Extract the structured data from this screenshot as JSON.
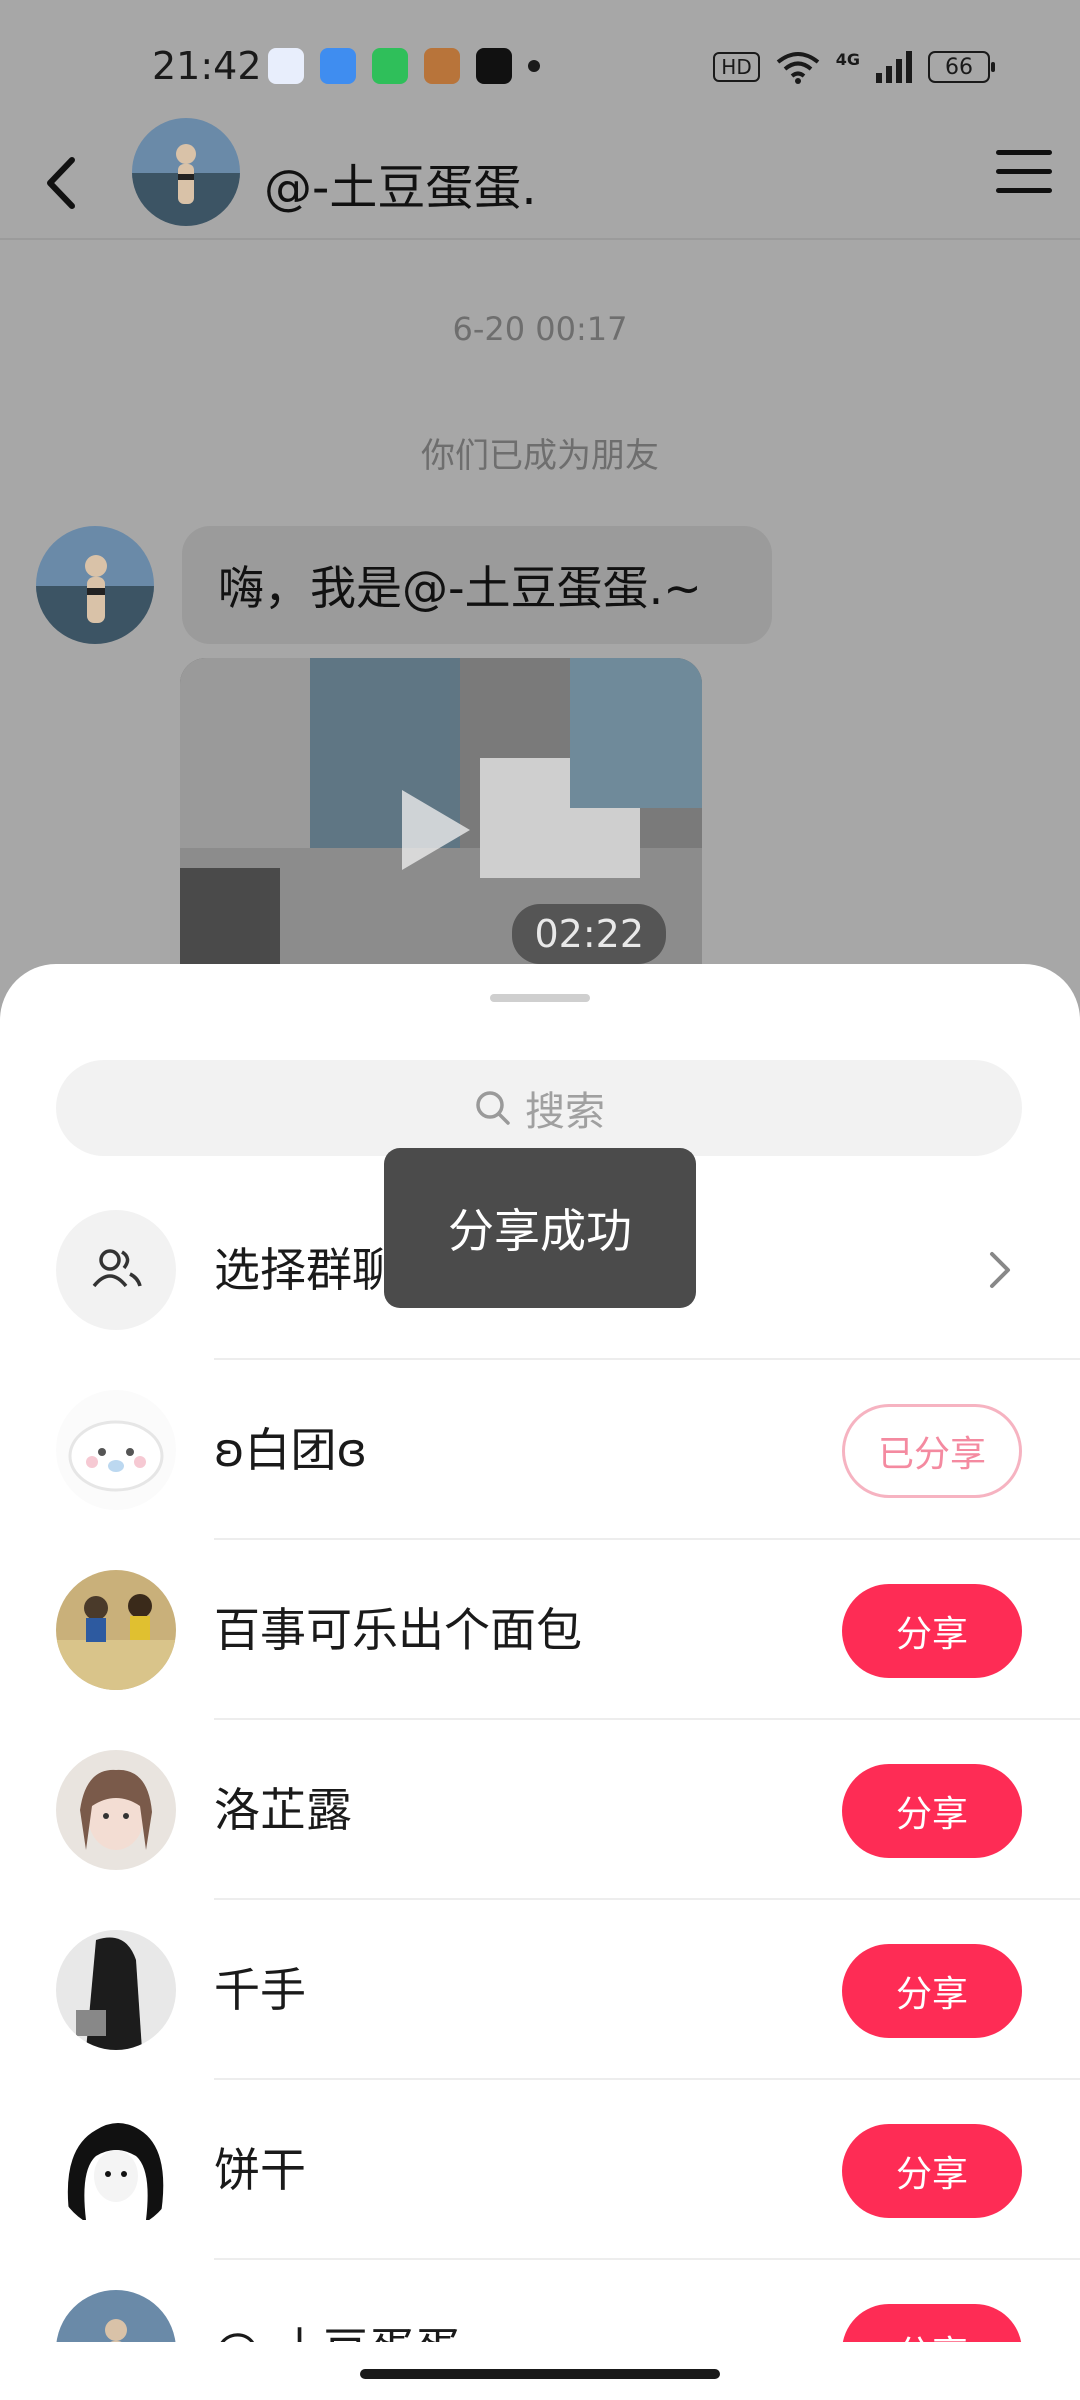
{
  "status_bar": {
    "time": "21:42",
    "apps": [
      "baidu-app-icon",
      "blue-app-icon",
      "green-app-icon",
      "game-app-icon",
      "tiktok-app-icon"
    ],
    "network": "4G",
    "hd": "HD",
    "battery": "66"
  },
  "header": {
    "title": "@-土豆蛋蛋."
  },
  "chat": {
    "timestamp": "6-20 00:17",
    "system_message": "你们已成为朋友",
    "greeting": "嗨，我是@-土豆蛋蛋.~",
    "video_duration": "02:22"
  },
  "share_sheet": {
    "search_placeholder": "搜索",
    "group_chat_label": "选择群聊",
    "contacts": [
      {
        "name": "ʚ白团ɞ",
        "button": "已分享",
        "state": "shared"
      },
      {
        "name": "百事可乐出个面包",
        "button": "分享",
        "state": "share"
      },
      {
        "name": "洛芷露",
        "button": "分享",
        "state": "share"
      },
      {
        "name": "千手",
        "button": "分享",
        "state": "share"
      },
      {
        "name": "饼干",
        "button": "分享",
        "state": "share"
      },
      {
        "name": "@-土豆蛋蛋",
        "button": "分享",
        "state": "share"
      }
    ]
  },
  "toast": "分享成功",
  "colors": {
    "accent": "#fe2c55",
    "shared_text": "#f48aa0",
    "overlay": "#a7a7a7"
  }
}
